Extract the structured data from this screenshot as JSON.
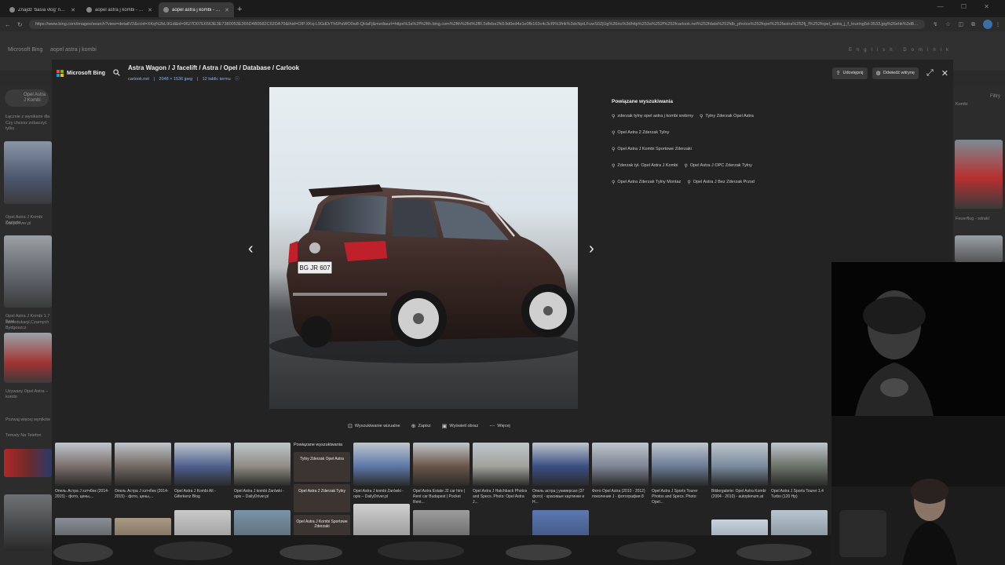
{
  "browser": {
    "tabs": [
      {
        "label": "Znajdź 'basia vlog' na TikToku | W"
      },
      {
        "label": "aopel astra j kombi - Wyszukaj"
      },
      {
        "label": "aopel astra j kombi - Wyszukaj Ob",
        "active": true
      }
    ],
    "url": "https://www.bing.com/images/search?view=detailV2&ccid=XKq%2bL9Gd&id=9627D07E6563E3E7380053E366D4B0582C62DA70&thid=OIP.XKq-L9GdDrTh6PaWO0w8-QHaFj&mediaurl=https%3a%2f%2fth.bing.com%2fth%2fid%2fR.5dfebe2fd19d0ed4e1e0fb163c4c3cf9%3frik%3dcNpiLFuwS0ZjUg%26riu%3dhttp%253a%252f%252fcarlook.net%252fdata%252fdb_photos%252fopel%252fastra%252fj_f%252fopel_astra_j_f_touring5d-3533.jpg%26ehk%3d8fo4u8tGclqXk%252bQ2l1BvhHPpwG0Ez"
  },
  "bg": {
    "logo": "Microsoft Bing",
    "search": "aopel astra j kombi",
    "lang": "English",
    "user": "Dominik",
    "chip": "Opel Astra\nJ Kombi",
    "hint1": "Łącznie z wynikami dla",
    "hint2": "Czy chcesz zobaczyć tylko",
    "left_cap1": "Opel Astra J Kombi Zarówki -",
    "left_cap1b": "DailyDriver.pl",
    "left_cap2": "Opel Astra J Kombi 1.7 Best",
    "left_cap2b": "samedukacji,Czarnych Bydgoszcz",
    "left_cap3": "Używany Opel Astra – kombi",
    "more": "Pozwaj więcej wyników",
    "topics": "Tematy Na Telefon",
    "right_cap": "Feuerflug - sdrakl",
    "right_chip": "Kombi",
    "filters": "Filtry"
  },
  "overlay": {
    "logo_label": "Microsoft Bing",
    "title": "Astra Wagon / J facelift / Astra / Opel / Database / Carlook",
    "source": "carlook.net",
    "dims": "2048 × 1536 jpeg",
    "more_topics": "12 tablic termu",
    "share_label": "Udostępnij",
    "visit_label": "Odwiedź witrynę"
  },
  "related": {
    "heading": "Powiązane wyszukiwania",
    "rows": [
      [
        {
          "label": "zderzak tylny opel astra j kombi srebrny"
        },
        {
          "label": "Tylny Zderzak Opel Astra"
        }
      ],
      [
        {
          "label": "Opel Astra 2 Zderzak Tylny"
        }
      ],
      [
        {
          "label": "Opel Astra J Kombi Sportowe Zderzaki"
        }
      ],
      [
        {
          "label": "Zderzak tył. Opel Astra J Kombi"
        },
        {
          "label": "Opel Astra J OPC Zderzak Tylny"
        }
      ],
      [
        {
          "label": "Opel Astra Zderzak Tylny Montaz"
        },
        {
          "label": "Opel Astra J Bez Zderzak Przod"
        }
      ]
    ]
  },
  "toolbar": {
    "visual_search": "Wyszukiwanie wizualne",
    "save": "Zapisz",
    "view_image": "Wyświetl obraz",
    "more": "Więcej"
  },
  "license_plate": "BG JR 607",
  "thumbnails": [
    {
      "caption": "Опель Астра J хэтчбек (2014-2015) - фото, цены,...",
      "color": "#7a6f6c"
    },
    {
      "caption": "Опель Астра J хэтчбек (2014-2015) - фото, цены,...",
      "color": "#716862"
    },
    {
      "caption": "Opel Astra J Kombi Alt - Giferkenz Blog",
      "color": "#4f5f8e"
    },
    {
      "caption": "Opel Astra J kombi Zarówki - opis – DailyDriver.pl",
      "color": "#8f8c84"
    },
    {
      "caption": "Opel Astra J kombi Zarówki - opis – DailyDriver.pl",
      "color": "#5d78a8"
    },
    {
      "caption": "Opel Astra Estate J2 car hire | Rent car Budapest | Pocket Rent...",
      "color": "#6a5548"
    },
    {
      "caption": "Opel Astra J Hatchback Photos and Specs. Photo: Opel Astra J...",
      "color": "#a2a29c"
    },
    {
      "caption": "Опель астра j универсал (37 фото) - красивые картинки и Н...",
      "color": "#3b4f82"
    },
    {
      "caption": "Фото Opel Astra (2010 - 2012) поколение J - фотография 8",
      "color": "#7d8494"
    },
    {
      "caption": "Opel Astra J Sports Tourer Photos and Specs. Photo: Opel...",
      "color": "#6a7b96"
    },
    {
      "caption": "Bildergalerie: Opel Astra Kombi (2004 - 2010) - autoplenum.at",
      "color": "#798a9d"
    },
    {
      "caption": "Opel Astra J Sports Tourer 1.4 Turbo (120 Hp)",
      "color": "#6b7269"
    }
  ],
  "related_mini": {
    "heading": "Powiązane wyszukiwania",
    "items": [
      {
        "label": "Tylny Zderzak Opel Astra"
      },
      {
        "label": "Opel Astra 2 Zderzak Tylny"
      },
      {
        "label": "Opel Astra J Kombi Sportowe Zderzaki"
      }
    ]
  },
  "colors": {
    "accent": "#8ab4f8",
    "car_body": "#3d2a26",
    "taillight": "#c0202a"
  }
}
